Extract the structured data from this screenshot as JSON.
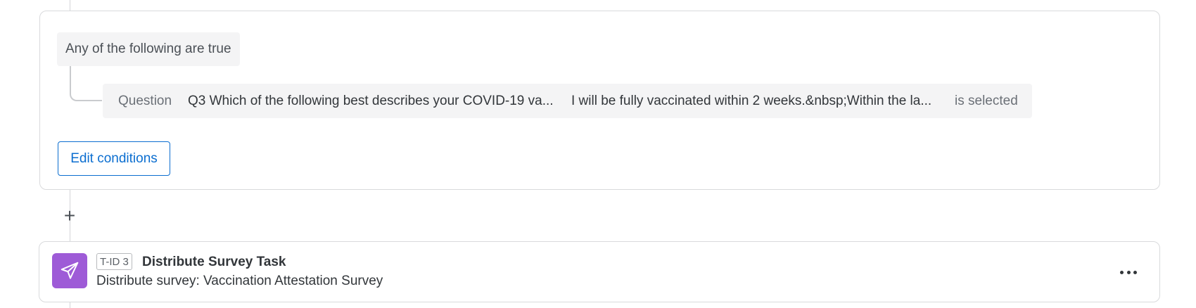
{
  "condition_group": {
    "logic_label": "Any of the following are true",
    "condition": {
      "type_label": "Question",
      "question": "Q3 Which of the following best describes your COVID-19 va...",
      "answer": "I will be fully vaccinated within 2 weeks.&nbsp;Within the la...",
      "operator": "is selected"
    },
    "edit_button_label": "Edit conditions"
  },
  "add_task_symbol": "+",
  "task": {
    "id_badge": "T-ID 3",
    "title": "Distribute Survey Task",
    "subtitle": "Distribute survey: Vaccination Attestation Survey",
    "icon": "paper-plane-icon",
    "icon_bg": "#9e5bd7",
    "more_icon": "more-horizontal-icon"
  },
  "colors": {
    "accent": "#0b6ed0",
    "task_icon": "#9e5bd7"
  }
}
